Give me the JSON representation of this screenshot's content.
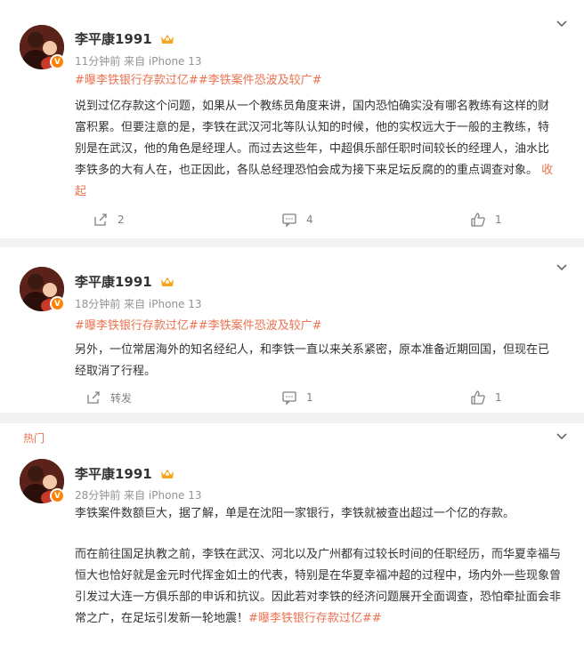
{
  "posts": [
    {
      "username": "李平康1991",
      "time": "11分钟前",
      "source": "来自 iPhone 13",
      "tags": "#曝李铁银行存款过亿##李铁案件恐波及较广#",
      "text": "说到过亿存款这个问题，如果从一个教练员角度来讲，国内恐怕确实没有哪名教练有这样的财富积累。但要注意的是，李铁在武汉河北等队认知的时候，他的实权远大于一般的主教练，特别是在武汉，他的角色是经理人。而过去这些年，中超俱乐部任职时间较长的经理人，油水比李铁多的大有人在，也正因此，各队总经理恐怕会成为接下来足坛反腐的的重点调查对象。",
      "collapse": "收起",
      "repost": "2",
      "comment": "4",
      "like": "1"
    },
    {
      "username": "李平康1991",
      "time": "18分钟前",
      "source": "来自 iPhone 13",
      "tags": "#曝李铁银行存款过亿##李铁案件恐波及较广#",
      "text": "另外，一位常居海外的知名经纪人，和李铁一直以来关系紧密，原本准备近期回国，但现在已经取消了行程。",
      "repost": "转发",
      "comment": "1",
      "like": "1"
    },
    {
      "section_label": "热门",
      "username": "李平康1991",
      "time": "28分钟前",
      "source": "来自 iPhone 13",
      "text1": "李铁案件数额巨大，据了解，单是在沈阳一家银行，李铁就被查出超过一个亿的存款。",
      "text2": "而在前往国足执教之前，李铁在武汉、河北以及广州都有过较长时间的任职经历，而华夏幸福与恒大也恰好就是金元时代挥金如土的代表，特别是在华夏幸福冲超的过程中，场内外一些现象曾引发过大连一方俱乐部的申诉和抗议。因此若对李铁的经济问题展开全面调查，恐怕牵扯面会非常之广，在足坛引发新一轮地震！",
      "tail_tag": "#曝李铁银行存款过亿##"
    }
  ],
  "colors": {
    "accent": "#eb7350",
    "meta": "#939393",
    "divider": "#f2f2f2",
    "verify": "#ff8200"
  }
}
